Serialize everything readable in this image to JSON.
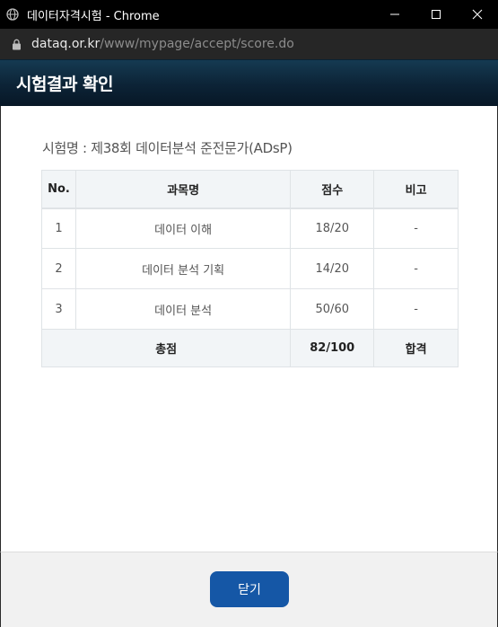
{
  "window": {
    "title": "데이터자격시험 - Chrome",
    "favicon": "globe-icon"
  },
  "address": {
    "host": "dataq.or.kr",
    "path": "/www/mypage/accept/score.do"
  },
  "modal": {
    "title": "시험결과 확인",
    "exam_label": "시험명 : 제38회 데이터분석 준전문가(ADsP)"
  },
  "table": {
    "headers": [
      "No.",
      "과목명",
      "점수",
      "비고"
    ],
    "rows": [
      {
        "no": "1",
        "subject": "데이터 이해",
        "score": "18/20",
        "note": "-"
      },
      {
        "no": "2",
        "subject": "데이터 분석 기획",
        "score": "14/20",
        "note": "-"
      },
      {
        "no": "3",
        "subject": "데이터 분석",
        "score": "50/60",
        "note": "-"
      }
    ],
    "total": {
      "label": "총점",
      "score": "82/100",
      "result": "합격"
    }
  },
  "footer": {
    "close_label": "닫기"
  },
  "colors": {
    "header_bg": "#0c2336",
    "button_bg": "#1557a6",
    "table_header_bg": "#f2f5f7"
  }
}
